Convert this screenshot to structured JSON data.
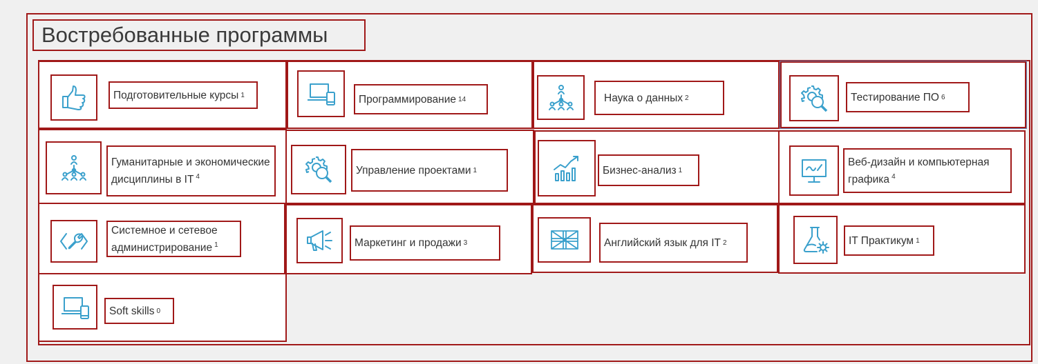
{
  "section": {
    "title": "Востребованные программы"
  },
  "accent_color": "#3aa0cc",
  "frame_color": "#a01818",
  "programs": [
    {
      "label": "Подготовительные курсы",
      "count": "1",
      "icon": "thumbs-up-icon"
    },
    {
      "label": "Программирование",
      "count": "14",
      "icon": "laptop-phone-icon"
    },
    {
      "label": "Наука о данных",
      "count": "2",
      "icon": "network-people-icon"
    },
    {
      "label": "Тестирование ПО",
      "count": "6",
      "icon": "gear-search-icon"
    },
    {
      "label": "Гуманитарные и экономические дисциплины в IT",
      "count": "4",
      "icon": "network-people-icon"
    },
    {
      "label": "Управление проектами",
      "count": "1",
      "icon": "gear-search-icon"
    },
    {
      "label": "Бизнес-анализ",
      "count": "1",
      "icon": "growth-chart-icon"
    },
    {
      "label": "Веб-дизайн и компьютерная графика",
      "count": "4",
      "icon": "monitor-pen-icon"
    },
    {
      "label": "Системное и сетевое администрирование",
      "count": "1",
      "icon": "code-wrench-icon"
    },
    {
      "label": "Маркетинг и продажи",
      "count": "3",
      "icon": "megaphone-icon"
    },
    {
      "label": "Английский язык для IT",
      "count": "2",
      "icon": "uk-flag-icon"
    },
    {
      "label": "IT Практикум",
      "count": "1",
      "icon": "flask-gear-icon"
    },
    {
      "label": "Soft skills",
      "count": "0",
      "icon": "laptop-phone-icon"
    }
  ]
}
